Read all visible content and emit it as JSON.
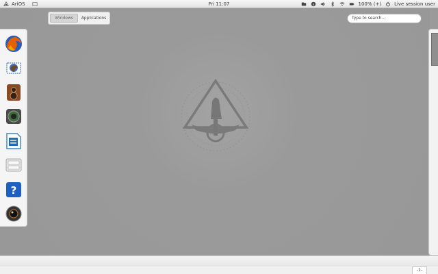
{
  "topbar": {
    "activities_label": "AriOS",
    "clock": "Fri 11:07",
    "battery": "100%",
    "battery_extra": "(+)",
    "user": "Live session user",
    "icons": [
      "arios-logo-icon",
      "window-icon",
      "folder-icon",
      "info-icon",
      "volume-icon",
      "bluetooth-icon",
      "wifi-icon",
      "battery-icon",
      "power-icon"
    ]
  },
  "overview": {
    "windows_label": "Windows",
    "applications_label": "Applications"
  },
  "search": {
    "placeholder": "Type to search..."
  },
  "dash": {
    "items": [
      {
        "name": "firefox-icon"
      },
      {
        "name": "thunderbird-icon"
      },
      {
        "name": "rhythmbox-icon"
      },
      {
        "name": "shotwell-icon"
      },
      {
        "name": "libreoffice-writer-icon"
      },
      {
        "name": "file-manager-icon"
      },
      {
        "name": "help-icon"
      },
      {
        "name": "cheese-camera-icon"
      }
    ]
  },
  "tray": {
    "page_indicator": "-1-"
  },
  "colors": {
    "desktop": "#9a9a9a",
    "panel": "#f5f5f5",
    "help_blue": "#1e5fc4"
  }
}
